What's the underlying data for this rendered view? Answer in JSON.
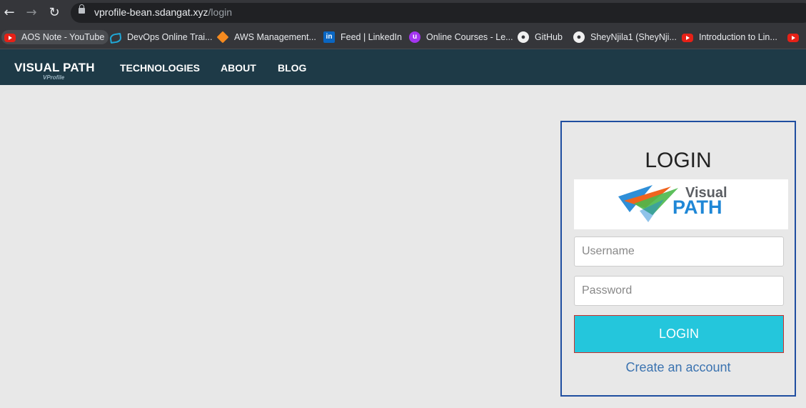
{
  "browser": {
    "url_host": "vprofile-bean.sdangat.xyz",
    "url_path": "/login",
    "bookmarks": [
      {
        "label": "AOS Note - YouTube",
        "icon": "youtube-icon"
      },
      {
        "label": "DevOps Online Trai...",
        "icon": "devops-eye-icon"
      },
      {
        "label": "AWS Management...",
        "icon": "aws-icon"
      },
      {
        "label": "Feed | LinkedIn",
        "icon": "linkedin-icon"
      },
      {
        "label": "Online Courses - Le...",
        "icon": "udemy-icon"
      },
      {
        "label": "GitHub",
        "icon": "github-icon"
      },
      {
        "label": "SheyNjila1 (SheyNji...",
        "icon": "github-icon"
      },
      {
        "label": "Introduction to Lin...",
        "icon": "youtube-icon"
      }
    ]
  },
  "nav": {
    "brand": "VISUAL PATH",
    "brand_sub": "VProfile",
    "links": [
      "TECHNOLOGIES",
      "ABOUT",
      "BLOG"
    ]
  },
  "login": {
    "title": "LOGIN",
    "logo_line1": "Visual",
    "logo_line2": "PATH",
    "username_placeholder": "Username",
    "password_placeholder": "Password",
    "button_label": "LOGIN",
    "create_account": "Create an account"
  },
  "colors": {
    "navbar": "#1e3a47",
    "login_button": "#24c6dc",
    "panel_border": "#1f4ea0",
    "link": "#3b73b0"
  }
}
